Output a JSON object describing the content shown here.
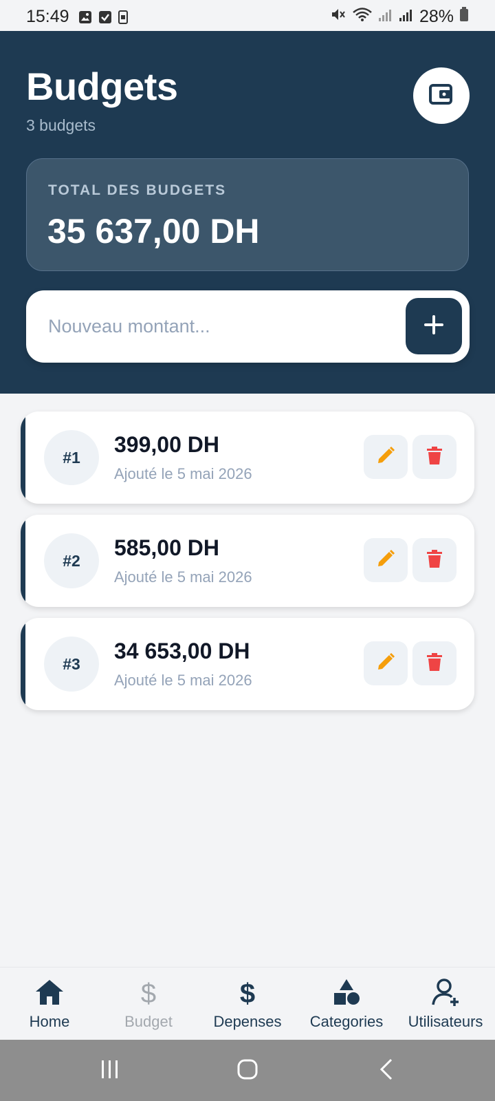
{
  "status_bar": {
    "time": "15:49",
    "battery": "28%"
  },
  "header": {
    "title": "Budgets",
    "subtitle": "3 budgets",
    "wallet_icon": "wallet-icon"
  },
  "total_card": {
    "label": "TOTAL DES BUDGETS",
    "value": "35 637,00 DH"
  },
  "add_bar": {
    "placeholder": "Nouveau montant...",
    "value": "",
    "add_icon": "plus-icon"
  },
  "budgets": [
    {
      "index": "#1",
      "amount": "399,00 DH",
      "date": "Ajouté le 5 mai 2026"
    },
    {
      "index": "#2",
      "amount": "585,00 DH",
      "date": "Ajouté le 5 mai 2026"
    },
    {
      "index": "#3",
      "amount": "34 653,00 DH",
      "date": "Ajouté le 5 mai 2026"
    }
  ],
  "bottom_nav": [
    {
      "label": "Home",
      "icon": "home-icon",
      "active": true
    },
    {
      "label": "Budget",
      "icon": "dollar-icon",
      "active": false
    },
    {
      "label": "Depenses",
      "icon": "dollar-icon",
      "active": true
    },
    {
      "label": "Categories",
      "icon": "shapes-icon",
      "active": true
    },
    {
      "label": "Utilisateurs",
      "icon": "user-add-icon",
      "active": true
    }
  ],
  "colors": {
    "primary": "#1e3a52",
    "edit": "#f59e0b",
    "delete": "#ef4444",
    "background": "#f3f4f6"
  }
}
